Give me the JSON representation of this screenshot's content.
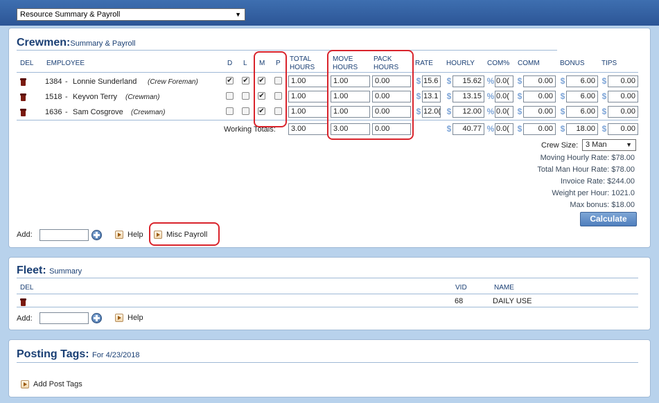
{
  "header": {
    "view_select": "Resource Summary & Payroll"
  },
  "crewmen": {
    "title": "Crewmen:",
    "subtitle": "Summary & Payroll",
    "columns": {
      "del": "DEL",
      "employee": "EMPLOYEE",
      "d": "D",
      "l": "L",
      "m": "M",
      "p": "P",
      "total_hours": [
        "TOTAL",
        "HOURS"
      ],
      "move_hours": [
        "MOVE",
        "HOURS"
      ],
      "pack_hours": [
        "PACK",
        "HOURS"
      ],
      "rate": "RATE",
      "hourly": "HOURLY",
      "com_pct": "COM%",
      "comm": "COMM",
      "bonus": "BONUS",
      "tips": "TIPS"
    },
    "rows": [
      {
        "id": "1384",
        "name": "Lonnie Sunderland",
        "role": "(Crew Foreman)",
        "d": true,
        "l": true,
        "m": true,
        "p": false,
        "total_hours": "1.00",
        "move_hours": "1.00",
        "pack_hours": "0.00",
        "rate": "15.6",
        "hourly": "15.62",
        "com_pct": "0.0(",
        "comm": "0.00",
        "bonus": "6.00",
        "tips": "0.00"
      },
      {
        "id": "1518",
        "name": "Keyvon Terry",
        "role": "(Crewman)",
        "d": false,
        "l": false,
        "m": true,
        "p": false,
        "total_hours": "1.00",
        "move_hours": "1.00",
        "pack_hours": "0.00",
        "rate": "13.1",
        "hourly": "13.15",
        "com_pct": "0.0(",
        "comm": "0.00",
        "bonus": "6.00",
        "tips": "0.00"
      },
      {
        "id": "1636",
        "name": "Sam Cosgrove",
        "role": "(Crewman)",
        "d": false,
        "l": false,
        "m": true,
        "p": false,
        "total_hours": "1.00",
        "move_hours": "1.00",
        "pack_hours": "0.00",
        "rate": "12.0(",
        "hourly": "12.00",
        "com_pct": "0.0(",
        "comm": "0.00",
        "bonus": "6.00",
        "tips": "0.00"
      }
    ],
    "totals": {
      "label": "Working Totals:",
      "total_hours": "3.00",
      "move_hours": "3.00",
      "pack_hours": "0.00",
      "hourly": "40.77",
      "com_pct": "0.0(",
      "comm": "0.00",
      "bonus": "18.00",
      "tips": "0.00"
    },
    "crew_size_label": "Crew Size:",
    "crew_size_value": "3 Man",
    "summary": [
      "Moving Hourly Rate: $78.00",
      "Total Man Hour Rate: $78.00",
      "Invoice Rate: $244.00",
      "Weight per Hour: 1021.0",
      "Max bonus: $18.00"
    ],
    "calculate": "Calculate",
    "add_label": "Add:",
    "help": "Help",
    "misc_payroll": "Misc Payroll"
  },
  "fleet": {
    "title": "Fleet:",
    "subtitle": "Summary",
    "columns": {
      "del": "DEL",
      "vid": "VID",
      "name": "NAME"
    },
    "rows": [
      {
        "vid": "68",
        "name": "DAILY USE"
      }
    ],
    "add_label": "Add:",
    "help": "Help"
  },
  "posting": {
    "title": "Posting Tags:",
    "subtitle": "For 4/23/2018",
    "add_post_tags": "Add Post Tags"
  },
  "symbols": {
    "dollar": "$",
    "percent": "%",
    "check": "✔"
  },
  "colors": {
    "accent": "#1a3f74",
    "highlight": "#d9242c",
    "topbar": "#2c5596"
  }
}
